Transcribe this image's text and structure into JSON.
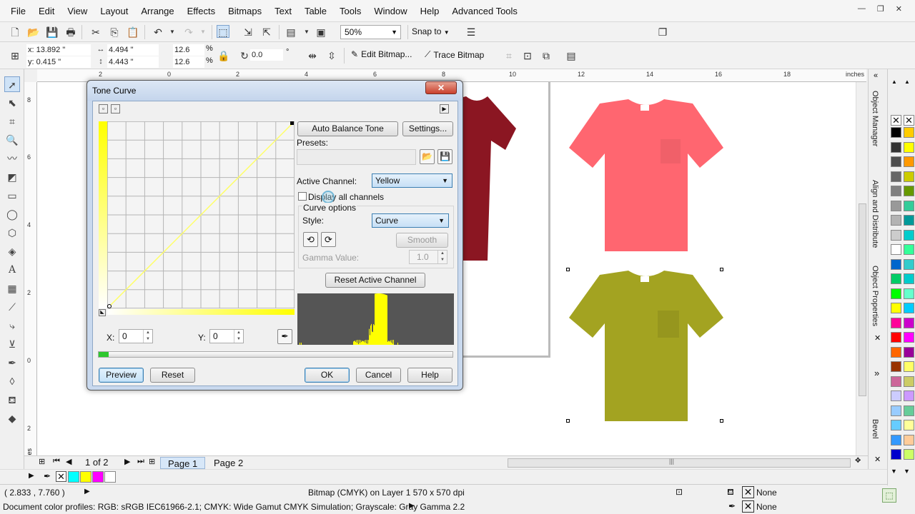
{
  "menu": [
    "File",
    "Edit",
    "View",
    "Layout",
    "Arrange",
    "Effects",
    "Bitmaps",
    "Text",
    "Table",
    "Tools",
    "Window",
    "Help",
    "Advanced Tools"
  ],
  "toolbar": {
    "zoom": "50%",
    "snap_to": "Snap to"
  },
  "property_bar": {
    "x": "x: 13.892 \"",
    "y": "y: 0.415 \"",
    "w": "4.494 \"",
    "h": "4.443 \"",
    "scale_x": "12.6",
    "scale_y": "12.6",
    "pct": "%",
    "angle": "0.0",
    "deg": "°",
    "edit_bitmap": "Edit Bitmap...",
    "trace_bitmap": "Trace Bitmap"
  },
  "ruler": {
    "units": "inches",
    "h_labels": [
      "2",
      "0",
      "2",
      "4",
      "6",
      "8",
      "10",
      "12",
      "14",
      "16",
      "18"
    ],
    "v_labels": [
      "8",
      "6",
      "4",
      "2",
      "0",
      "2"
    ],
    "v_units": "inches"
  },
  "docker": {
    "tabs": [
      "Object Manager",
      "Align and Distribute",
      "Object Properties",
      "Bevel"
    ]
  },
  "palette": {
    "col1": [
      "#000000",
      "#333333",
      "#4d4d4d",
      "#666666",
      "#808080",
      "#999999",
      "#b3b3b3",
      "#cccccc",
      "#ffffff",
      "#0066cc",
      "#00cc66",
      "#00ff00",
      "#ffff00",
      "#ff0099",
      "#ff0000",
      "#ff6600",
      "#993300",
      "#cc6699",
      "#ccccff",
      "#99ccff",
      "#66ccff",
      "#3399ff",
      "#0000cc"
    ],
    "col2": [
      "#ffcc00",
      "#ffff00",
      "#ff9900",
      "#cccc00",
      "#669900",
      "#33cc99",
      "#009999",
      "#00cccc",
      "#33ff99",
      "#33cccc",
      "#00cccc",
      "#66ffcc",
      "#00ccff",
      "#cc00cc",
      "#ff00ff",
      "#990099",
      "#ffff66",
      "#cccc66",
      "#cc99ff",
      "#66cc99",
      "#ffff99",
      "#ffcc99",
      "#ccff66"
    ]
  },
  "pages": {
    "counter": "1 of 2",
    "tabs": [
      "Page 1",
      "Page 2"
    ]
  },
  "colorbar": {
    "swatches": [
      "#00ffff",
      "#ffff00",
      "#ff00ff",
      "#ffffff"
    ]
  },
  "status": {
    "coords": "( 2.833 , 7.760 )",
    "object_info": "Bitmap (CMYK) on Layer 1 570 x 570 dpi",
    "profiles": "Document color profiles: RGB: sRGB IEC61966-2.1; CMYK: Wide Gamut CMYK Simulation; Grayscale: Gray Gamma 2.2",
    "fill": "None",
    "outline": "None"
  },
  "shirts": {
    "colors": [
      "#8b1622",
      "#ff6670",
      "#a3a321"
    ]
  },
  "dialog": {
    "title": "Tone Curve",
    "close": "✕",
    "auto_balance": "Auto Balance Tone",
    "settings": "Settings...",
    "presets_label": "Presets:",
    "active_channel_label": "Active Channel:",
    "active_channel_value": "Yellow",
    "display_all": "Display all channels",
    "curve_options": "Curve options",
    "style_label": "Style:",
    "style_value": "Curve",
    "smooth": "Smooth",
    "gamma_label": "Gamma Value:",
    "gamma_value": "1.0",
    "reset_channel": "Reset Active Channel",
    "x_label": "X:",
    "x_value": "0",
    "y_label": "Y:",
    "y_value": "0",
    "preview": "Preview",
    "reset": "Reset",
    "ok": "OK",
    "cancel": "Cancel",
    "help": "Help",
    "curve_color": "#ffff66",
    "histogram_color": "#ffff00"
  }
}
